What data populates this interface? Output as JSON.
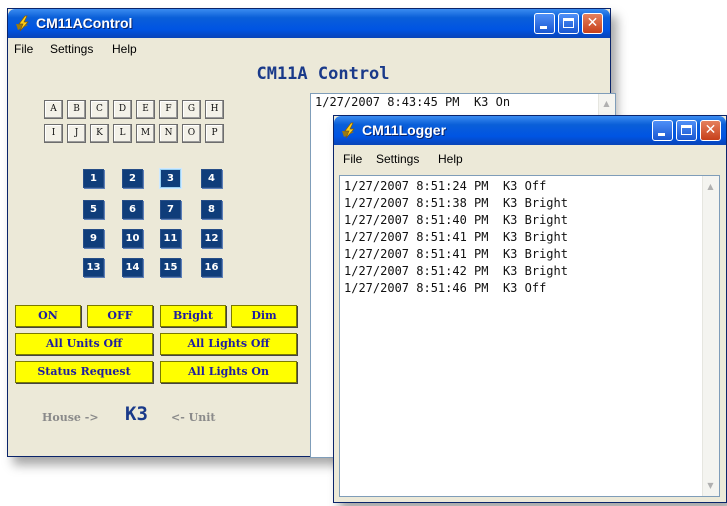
{
  "control_window": {
    "title": "CM11AControl",
    "menu": [
      "File",
      "Settings",
      "Help"
    ],
    "heading": "CM11A Control",
    "house_codes": [
      "A",
      "B",
      "C",
      "D",
      "E",
      "F",
      "G",
      "H",
      "I",
      "J",
      "K",
      "L",
      "M",
      "N",
      "O",
      "P"
    ],
    "unit_codes": [
      "1",
      "2",
      "3",
      "4",
      "5",
      "6",
      "7",
      "8",
      "9",
      "10",
      "11",
      "12",
      "13",
      "14",
      "15",
      "16"
    ],
    "selected_unit": "3",
    "command_buttons": [
      "ON",
      "OFF",
      "Bright",
      "Dim",
      "All Units Off",
      "All Lights Off",
      "Status Request",
      "All Lights On"
    ],
    "house_label": "House ->",
    "current_code": "K3",
    "unit_label": "<- Unit",
    "log_lines": [
      "1/27/2007 8:43:45 PM  K3 On"
    ]
  },
  "logger_window": {
    "title": "CM11Logger",
    "menu": [
      "File",
      "Settings",
      "Help"
    ],
    "log_lines": [
      "1/27/2007 8:51:24 PM  K3 Off",
      "1/27/2007 8:51:38 PM  K3 Bright",
      "1/27/2007 8:51:40 PM  K3 Bright",
      "1/27/2007 8:51:41 PM  K3 Bright",
      "1/27/2007 8:51:41 PM  K3 Bright",
      "1/27/2007 8:51:42 PM  K3 Bright",
      "1/27/2007 8:51:46 PM  K3 Off"
    ]
  },
  "icons": {
    "app_icon": "lightning-bolt-icon",
    "minimize": "minimize-icon",
    "maximize": "maximize-icon",
    "close": "close-icon"
  },
  "colors": {
    "titlebar": "#0054e3",
    "unit_button": "#0f3d7a",
    "command_button": "#ffff00",
    "heading": "#1a3a8a"
  }
}
